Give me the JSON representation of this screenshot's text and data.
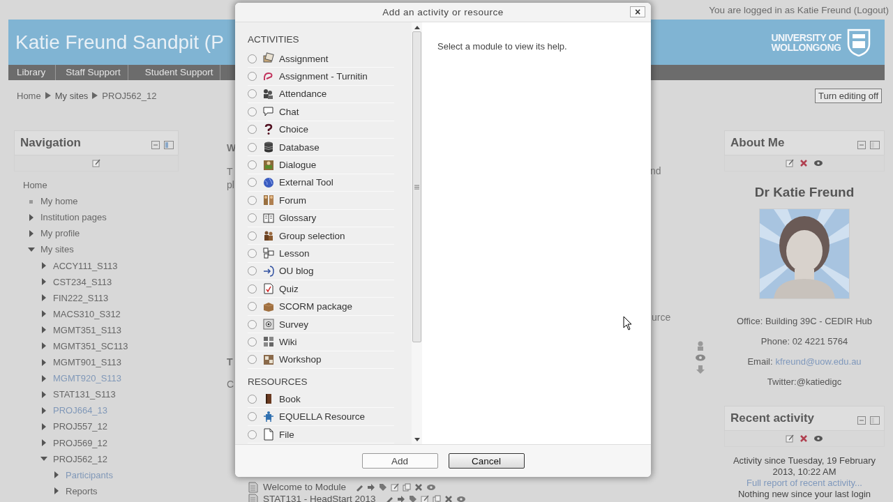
{
  "login_text": "You are logged in as Katie Freund (Logout)",
  "banner": {
    "site_title": "Katie Freund Sandpit (P",
    "logo_lines": [
      "UNIVERSITY OF",
      "WOLLONGONG"
    ]
  },
  "menu": [
    "Library",
    "Staff Support",
    "Student Support"
  ],
  "breadcrumb": [
    "Home",
    "My sites",
    "PROJ562_12"
  ],
  "edit_button": "Turn editing off",
  "navigation": {
    "title": "Navigation",
    "tree": [
      {
        "label": "Home",
        "kind": "root",
        "link": false,
        "children": [
          {
            "label": "My home",
            "kind": "leaf",
            "link": false
          },
          {
            "label": "Institution pages",
            "kind": "branch",
            "expanded": false,
            "link": false
          },
          {
            "label": "My profile",
            "kind": "branch",
            "expanded": false,
            "link": false
          },
          {
            "label": "My sites",
            "kind": "branch",
            "expanded": true,
            "link": false,
            "children": [
              {
                "label": "ACCY111_S113",
                "kind": "branch",
                "expanded": false,
                "link": false
              },
              {
                "label": "CST234_S113",
                "kind": "branch",
                "expanded": false,
                "link": false
              },
              {
                "label": "FIN222_S113",
                "kind": "branch",
                "expanded": false,
                "link": false
              },
              {
                "label": "MACS310_S312",
                "kind": "branch",
                "expanded": false,
                "link": false
              },
              {
                "label": "MGMT351_S113",
                "kind": "branch",
                "expanded": false,
                "link": false
              },
              {
                "label": "MGMT351_SC113",
                "kind": "branch",
                "expanded": false,
                "link": false
              },
              {
                "label": "MGMT901_S113",
                "kind": "branch",
                "expanded": false,
                "link": false
              },
              {
                "label": "MGMT920_S113",
                "kind": "branch",
                "expanded": false,
                "link": true
              },
              {
                "label": "STAT131_S113",
                "kind": "branch",
                "expanded": false,
                "link": false
              },
              {
                "label": "PROJ664_13",
                "kind": "branch",
                "expanded": false,
                "link": true
              },
              {
                "label": "PROJ557_12",
                "kind": "branch",
                "expanded": false,
                "link": false
              },
              {
                "label": "PROJ569_12",
                "kind": "branch",
                "expanded": false,
                "link": false
              },
              {
                "label": "PROJ562_12",
                "kind": "branch",
                "expanded": true,
                "link": false,
                "children": [
                  {
                    "label": "Participants",
                    "kind": "branch",
                    "expanded": false,
                    "link": true
                  },
                  {
                    "label": "Reports",
                    "kind": "branch",
                    "expanded": false,
                    "link": false
                  }
                ]
              }
            ]
          }
        ]
      }
    ]
  },
  "main_fragments": {
    "left": [
      "W",
      "T",
      "pl",
      "T",
      "C"
    ],
    "right": [
      "nd",
      "urce"
    ]
  },
  "section_items": [
    {
      "label": "Welcome to Module"
    },
    {
      "label": "STAT131 - HeadStart 2013"
    }
  ],
  "about_me": {
    "title": "About Me",
    "name": "Dr Katie Freund",
    "office": "Office: Building 39C - CEDIR Hub",
    "phone": "Phone: 02 4221 5764",
    "email_label": "Email:",
    "email": "kfreund@uow.edu.au",
    "twitter": "Twitter:@katiedigc"
  },
  "recent_activity": {
    "title": "Recent activity",
    "since": "Activity since Tuesday, 19 February 2013, 10:22 AM",
    "report_link": "Full report of recent activity...",
    "status": "Nothing new since your last login"
  },
  "dialog": {
    "title": "Add an activity or resource",
    "close": "×",
    "help": "Select a module to view its help.",
    "groups": [
      {
        "heading": "ACTIVITIES",
        "items": [
          {
            "label": "Assignment",
            "selected": false
          },
          {
            "label": "Assignment - Turnitin",
            "selected": false
          },
          {
            "label": "Attendance",
            "selected": false
          },
          {
            "label": "Chat",
            "selected": false
          },
          {
            "label": "Choice",
            "selected": false
          },
          {
            "label": "Database",
            "selected": false
          },
          {
            "label": "Dialogue",
            "selected": false
          },
          {
            "label": "External Tool",
            "selected": false
          },
          {
            "label": "Forum",
            "selected": false
          },
          {
            "label": "Glossary",
            "selected": false
          },
          {
            "label": "Group selection",
            "selected": false
          },
          {
            "label": "Lesson",
            "selected": false
          },
          {
            "label": "OU blog",
            "selected": false
          },
          {
            "label": "Quiz",
            "selected": false
          },
          {
            "label": "SCORM package",
            "selected": false
          },
          {
            "label": "Survey",
            "selected": false
          },
          {
            "label": "Wiki",
            "selected": false
          },
          {
            "label": "Workshop",
            "selected": false
          }
        ]
      },
      {
        "heading": "RESOURCES",
        "items": [
          {
            "label": "Book",
            "selected": false
          },
          {
            "label": "EQUELLA Resource",
            "selected": false
          },
          {
            "label": "File",
            "selected": false
          }
        ]
      }
    ],
    "buttons": [
      "Add",
      "Cancel"
    ]
  }
}
